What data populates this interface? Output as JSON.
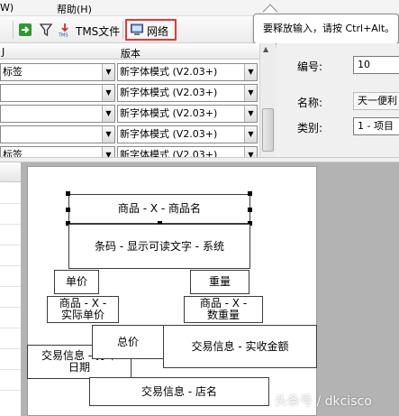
{
  "menu": {
    "partial_item": "W)",
    "help": "帮助(H)"
  },
  "toolbar": {
    "tms_label": "TMS文件",
    "network_label": "网络"
  },
  "tooltip": {
    "text": "要释放输入，请按 Ctrl+Alt。"
  },
  "grid": {
    "col1_header": "J",
    "col2_header": "版本",
    "rows": [
      {
        "col1": "标签",
        "col2": "新字体模式 (V2.03+)"
      },
      {
        "col1": "",
        "col2": "新字体模式 (V2.03+)"
      },
      {
        "col1": "",
        "col2": "新字体模式 (V2.03+)"
      },
      {
        "col1": "",
        "col2": "新字体模式 (V2.03+)"
      },
      {
        "col1": "标签",
        "col2": "新字体模式 (V2.03+)"
      }
    ]
  },
  "properties": {
    "number_label": "编号:",
    "number_value": "10",
    "name_label": "名称:",
    "name_value": "天一便利",
    "category_label": "类别:",
    "category_value": "1 - 项目"
  },
  "label_canvas": {
    "items": {
      "product_name": "商品 - X - 商品名",
      "barcode": "条码 - 显示可读文字 - 系统",
      "unit_price": "单价",
      "weight": "重量",
      "actual_unit_price": "商品 - X -\n实际单价",
      "net_weight": "商品 - X -\n数重量",
      "total_price": "总价",
      "received_amount": "交易信息 - 实收金额",
      "print_date": "交易信息 - 打印\n日期",
      "store_name": "交易信息 - 店名"
    }
  },
  "watermark": {
    "text": "头条号 / dkcisco"
  }
}
